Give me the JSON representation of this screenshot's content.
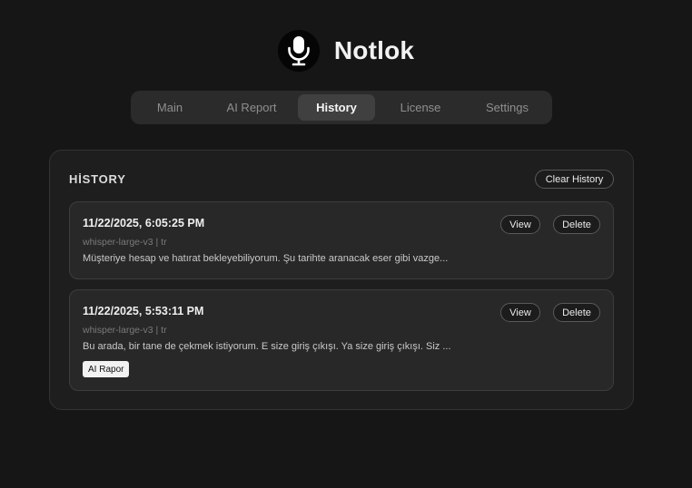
{
  "app": {
    "title": "Notlok",
    "logo_icon": "microphone-icon"
  },
  "tabs": [
    {
      "label": "Main",
      "active": false
    },
    {
      "label": "AI Report",
      "active": false
    },
    {
      "label": "History",
      "active": true
    },
    {
      "label": "License",
      "active": false
    },
    {
      "label": "Settings",
      "active": false
    }
  ],
  "history": {
    "title": "HİSTORY",
    "clear_label": "Clear History",
    "entries": [
      {
        "date": "11/22/2025, 6:05:25 PM",
        "meta": "whisper-large-v3 | tr",
        "text": "Müşteriye hesap ve hatırat bekleyebiliyorum. Şu tarihte aranacak eser gibi vazge...",
        "view_label": "View",
        "delete_label": "Delete"
      },
      {
        "date": "11/22/2025, 5:53:11 PM",
        "meta": "whisper-large-v3 | tr",
        "text": "Bu arada, bir tane de çekmek istiyorum. E size giriş çıkışı. Ya size giriş çıkışı. Siz ...",
        "view_label": "View",
        "delete_label": "Delete",
        "tag": "AI Rapor"
      }
    ]
  },
  "colors": {
    "background": "#161616",
    "panel": "#1e1e1e",
    "card": "#282828",
    "active_tab": "#404040"
  }
}
